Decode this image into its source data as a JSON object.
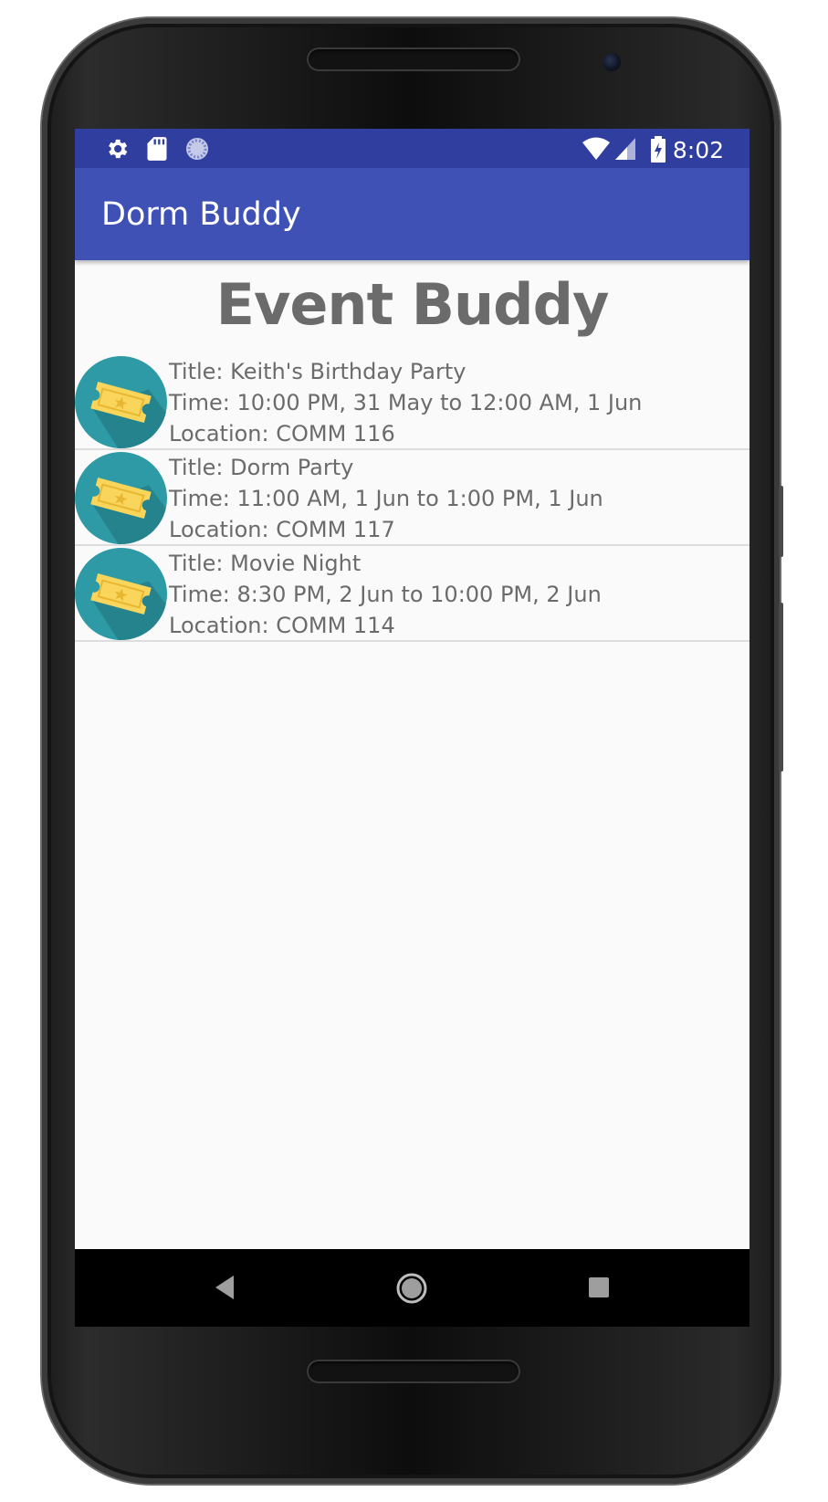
{
  "statusbar": {
    "time": "8:02",
    "icons": [
      "gear-icon",
      "sd-card-icon",
      "sync-icon",
      "wifi-icon",
      "cellular-icon",
      "battery-charging-icon"
    ]
  },
  "appbar": {
    "title": "Dorm Buddy"
  },
  "main": {
    "heading": "Event Buddy",
    "events": [
      {
        "title": "Title: Keith's Birthday Party",
        "time": "Time: 10:00 PM, 31 May to 12:00 AM, 1 Jun",
        "location": "Location: COMM 116",
        "icon": "ticket-icon"
      },
      {
        "title": "Title: Dorm Party",
        "time": "Time: 11:00 AM, 1 Jun to 1:00 PM, 1 Jun",
        "location": "Location: COMM 117",
        "icon": "ticket-icon"
      },
      {
        "title": "Title: Movie Night",
        "time": "Time: 8:30 PM, 2 Jun to 10:00 PM, 2 Jun",
        "location": "Location: COMM 114",
        "icon": "ticket-icon"
      }
    ]
  },
  "navbar": {
    "buttons": [
      "back-icon",
      "home-icon",
      "recents-icon"
    ]
  },
  "colors": {
    "statusbar": "#303f9f",
    "appbar": "#3f51b5",
    "icon_circle": "#2e9aa5",
    "ticket": "#f9d55b",
    "text": "#6b6b6b"
  }
}
